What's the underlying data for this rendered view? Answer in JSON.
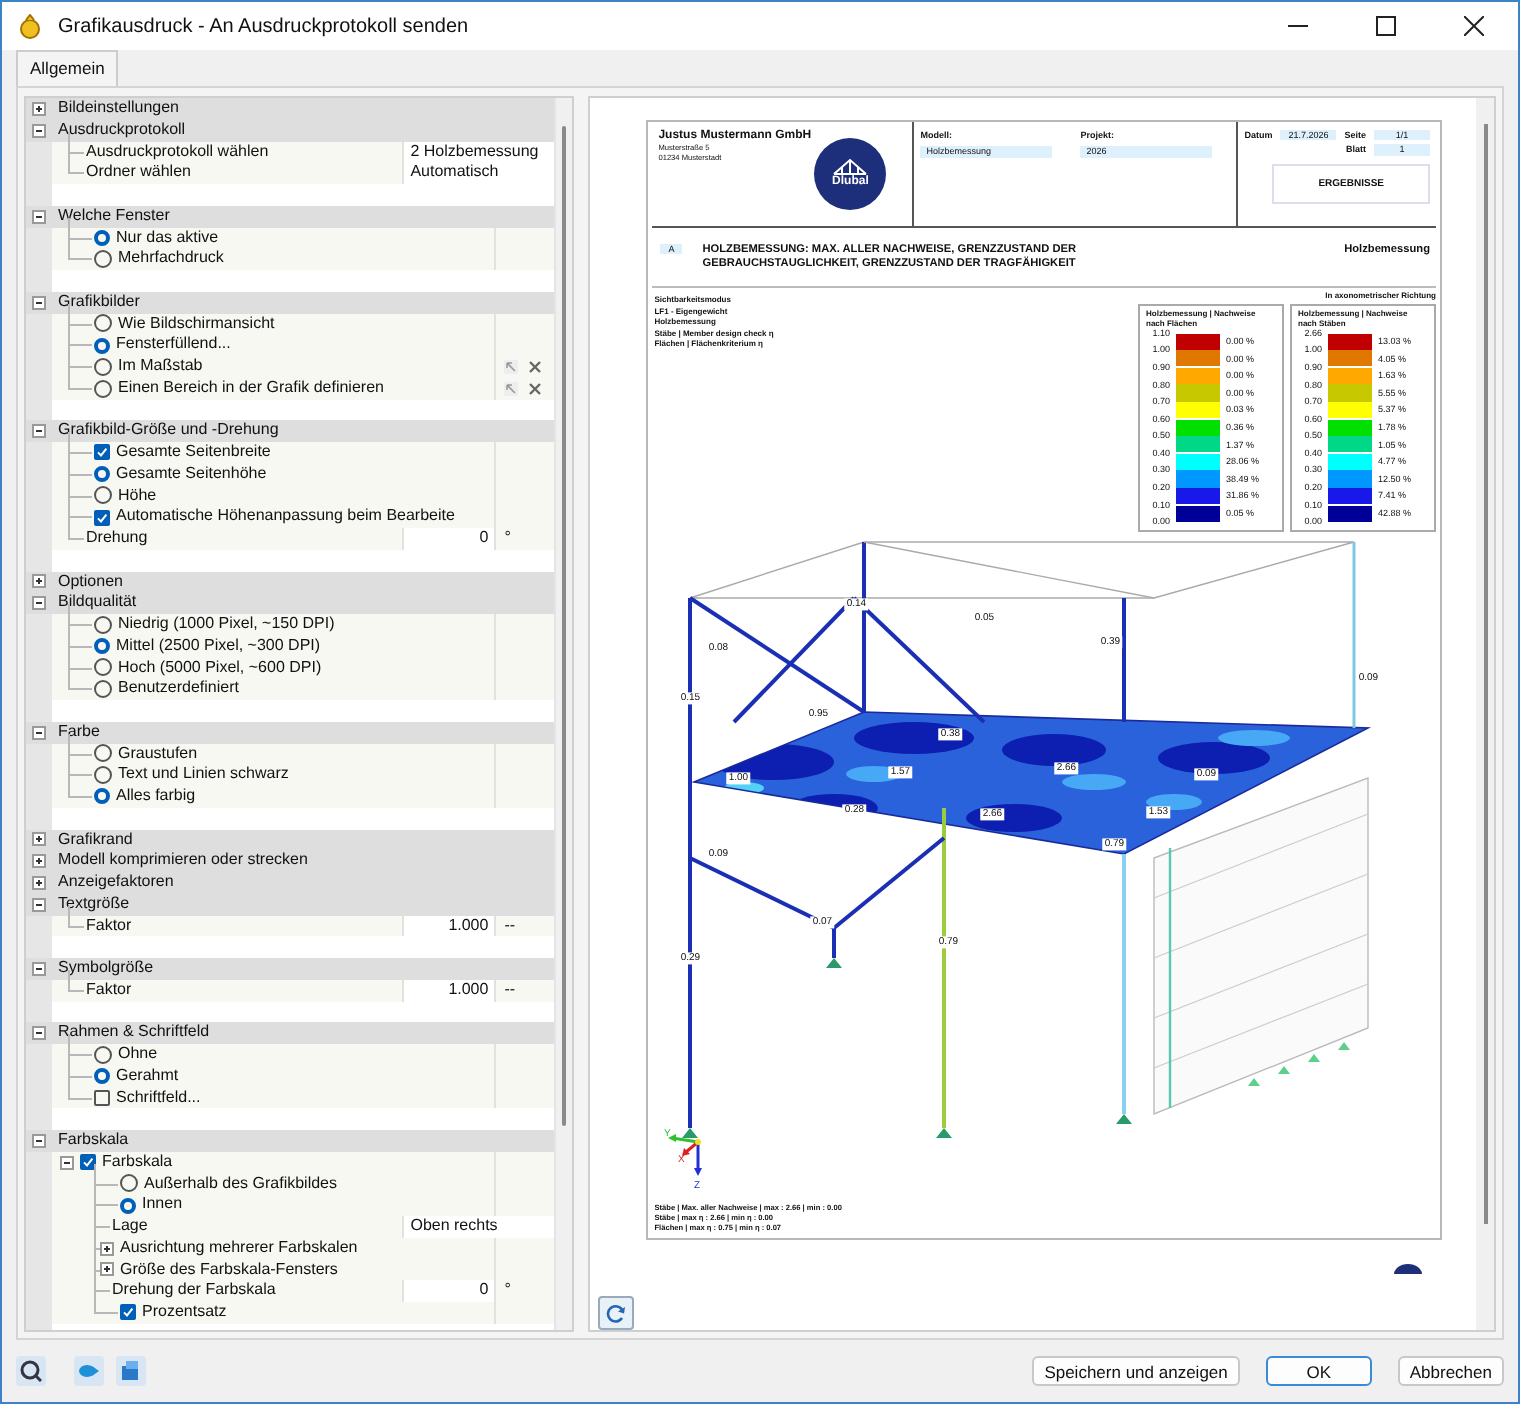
{
  "window": {
    "title": "Grafikausdruck - An Ausdruckprotokoll senden"
  },
  "tabs": [
    {
      "label": "Allgemein",
      "selected": true
    }
  ],
  "settings": [
    {
      "label": "Bildeinstellungen",
      "expanded": false
    },
    {
      "label": "Ausdruckprotokoll",
      "expanded": true,
      "rows": [
        {
          "kind": "field",
          "label": "Ausdruckprotokoll wählen",
          "value": "2 Holzbemessung"
        },
        {
          "kind": "field",
          "label": "Ordner wählen",
          "value": "Automatisch"
        }
      ]
    },
    {
      "label": "Welche Fenster",
      "expanded": true,
      "rows": [
        {
          "kind": "radio",
          "label": "Nur das aktive",
          "selected": true
        },
        {
          "kind": "radio",
          "label": "Mehrfachdruck",
          "selected": false
        }
      ]
    },
    {
      "label": "Grafikbilder",
      "expanded": true,
      "rows": [
        {
          "kind": "radio",
          "label": "Wie Bildschirmansicht",
          "selected": false
        },
        {
          "kind": "radio",
          "label": "Fensterfüllend...",
          "selected": true
        },
        {
          "kind": "radio",
          "label": "Im Maßstab",
          "selected": false,
          "tools": true
        },
        {
          "kind": "radio",
          "label": "Einen Bereich in der Grafik definieren",
          "selected": false,
          "tools": true
        }
      ]
    },
    {
      "label": "Grafikbild-Größe und -Drehung",
      "expanded": true,
      "rows": [
        {
          "kind": "checkbox",
          "label": "Gesamte Seitenbreite",
          "checked": true
        },
        {
          "kind": "radio",
          "label": "Gesamte Seitenhöhe",
          "selected": true
        },
        {
          "kind": "radio",
          "label": "Höhe",
          "selected": false
        },
        {
          "kind": "checkbox",
          "label": "Automatische Höhenanpassung beim Bearbeite",
          "checked": true
        },
        {
          "kind": "field",
          "label": "Drehung",
          "value": "0",
          "unit": "°"
        }
      ]
    },
    {
      "label": "Optionen",
      "expanded": false
    },
    {
      "label": "Bildqualität",
      "expanded": true,
      "rows": [
        {
          "kind": "radio",
          "label": "Niedrig (1000 Pixel, ~150 DPI)",
          "selected": false
        },
        {
          "kind": "radio",
          "label": "Mittel (2500 Pixel, ~300 DPI)",
          "selected": true
        },
        {
          "kind": "radio",
          "label": "Hoch (5000 Pixel, ~600 DPI)",
          "selected": false
        },
        {
          "kind": "radio",
          "label": "Benutzerdefiniert",
          "selected": false
        }
      ]
    },
    {
      "label": "Farbe",
      "expanded": true,
      "rows": [
        {
          "kind": "radio",
          "label": "Graustufen",
          "selected": false
        },
        {
          "kind": "radio",
          "label": "Text und Linien schwarz",
          "selected": false
        },
        {
          "kind": "radio",
          "label": "Alles farbig",
          "selected": true
        }
      ]
    },
    {
      "label": "Grafikrand",
      "expanded": false
    },
    {
      "label": "Modell komprimieren oder strecken",
      "expanded": false
    },
    {
      "label": "Anzeigefaktoren",
      "expanded": false
    },
    {
      "label": "Textgröße",
      "expanded": true,
      "rows": [
        {
          "kind": "field",
          "label": "Faktor",
          "value": "1.000",
          "unit": "--"
        }
      ]
    },
    {
      "label": "Symbolgröße",
      "expanded": true,
      "rows": [
        {
          "kind": "field",
          "label": "Faktor",
          "value": "1.000",
          "unit": "--"
        }
      ]
    },
    {
      "label": "Rahmen & Schriftfeld",
      "expanded": true,
      "rows": [
        {
          "kind": "radio",
          "label": "Ohne",
          "selected": false
        },
        {
          "kind": "radio",
          "label": "Gerahmt",
          "selected": true
        },
        {
          "kind": "checkbox",
          "label": "Schriftfeld...",
          "checked": false
        }
      ]
    },
    {
      "label": "Farbskala",
      "expanded": true,
      "rows": [
        {
          "kind": "checkbox",
          "label": "Farbskala",
          "checked": true,
          "expanded": true,
          "children": [
            {
              "kind": "radio",
              "label": "Außerhalb des Grafikbildes",
              "selected": false
            },
            {
              "kind": "radio",
              "label": "Innen",
              "selected": true
            },
            {
              "kind": "field",
              "label": "Lage",
              "value": "Oben rechts"
            },
            {
              "kind": "group",
              "label": "Ausrichtung mehrerer Farbskalen",
              "expanded": false
            },
            {
              "kind": "group",
              "label": "Größe des Farbskala-Fensters",
              "expanded": false
            },
            {
              "kind": "field",
              "label": "Drehung der Farbskala",
              "value": "0",
              "unit": "°"
            },
            {
              "kind": "checkbox",
              "label": "Prozentsatz",
              "checked": true
            }
          ]
        }
      ]
    }
  ],
  "preview": {
    "header": {
      "company": "Justus Mustermann GmbH",
      "address": [
        "Musterstraße 5",
        "01234 Musterstadt"
      ],
      "logo": "Dlubal",
      "model_label": "Modell:",
      "model": "Holzbemessung",
      "project_label": "Projekt:",
      "project": "2026",
      "date_label": "Datum",
      "date": "21.7.2026",
      "page_label": "Seite",
      "page": "1/1",
      "sheet_label": "Blatt",
      "sheet": "1",
      "badge": "ERGEBNISSE"
    },
    "section": {
      "letter": "A",
      "title": "HOLZBEMESSUNG: MAX. ALLER NACHWEISE, GRENZZUSTAND DER GEBRAUCHSTAUGLICHKEIT, GRENZZUSTAND DER TRAGFÄHIGKEIT",
      "tag": "Holzbemessung"
    },
    "info_lines": [
      "Sichtbarkeitsmodus",
      "LF1 - Eigengewicht",
      "Holzbemessung",
      "Stäbe | Member design check η",
      "Flächen | Flächenkriterium η"
    ],
    "view_note": "In axonometrischer Richtung",
    "legends": [
      {
        "title": "Holzbemessung | Nachweise nach Flächen",
        "ticks": [
          "1.10",
          "1.00",
          "0.90",
          "0.80",
          "0.70",
          "0.60",
          "0.50",
          "0.40",
          "0.30",
          "0.20",
          "0.10",
          "0.00"
        ],
        "bands": [
          {
            "color": "#c00000",
            "percent": "0.00 %"
          },
          {
            "color": "#e07800",
            "percent": "0.00 %"
          },
          {
            "color": "#ffa800",
            "percent": "0.00 %"
          },
          {
            "color": "#c8c800",
            "percent": "0.00 %"
          },
          {
            "color": "#ffff00",
            "percent": "0.03 %"
          },
          {
            "color": "#00e000",
            "percent": "0.36 %"
          },
          {
            "color": "#00d888",
            "percent": "1.37 %"
          },
          {
            "color": "#00ffff",
            "percent": "28.06 %"
          },
          {
            "color": "#0098ff",
            "percent": "38.49 %"
          },
          {
            "color": "#1818e8",
            "percent": "31.86 %"
          },
          {
            "color": "#000098",
            "percent": "0.05 %"
          }
        ]
      },
      {
        "title": "Holzbemessung | Nachweise nach Stäben",
        "ticks": [
          "2.66",
          "1.00",
          "0.90",
          "0.80",
          "0.70",
          "0.60",
          "0.50",
          "0.40",
          "0.30",
          "0.20",
          "0.10",
          "0.00"
        ],
        "bands": [
          {
            "color": "#c00000",
            "percent": "13.03 %"
          },
          {
            "color": "#e07800",
            "percent": "4.05 %"
          },
          {
            "color": "#ffa800",
            "percent": "1.63 %"
          },
          {
            "color": "#c8c800",
            "percent": "5.55 %"
          },
          {
            "color": "#ffff00",
            "percent": "5.37 %"
          },
          {
            "color": "#00e000",
            "percent": "1.78 %"
          },
          {
            "color": "#00d888",
            "percent": "1.05 %"
          },
          {
            "color": "#00ffff",
            "percent": "4.77 %"
          },
          {
            "color": "#0098ff",
            "percent": "12.50 %"
          },
          {
            "color": "#1818e8",
            "percent": "7.41 %"
          },
          {
            "color": "#000098",
            "percent": "42.88 %"
          }
        ]
      }
    ],
    "member_labels": [
      "0.14",
      "0.05",
      "0.08",
      "0.39",
      "0.15",
      "0.09",
      "0.95",
      "0.38",
      "1.00",
      "1.57",
      "2.66",
      "0.09",
      "0.28",
      "2.66",
      "1.53",
      "0.79",
      "0.09",
      "0.29",
      "0.07",
      "0.79"
    ],
    "axis_labels": [
      "Y",
      "X",
      "Z"
    ],
    "footer_lines": [
      "Stäbe | Max. aller Nachweise | max : 2.66 | min : 0.00",
      "Stäbe | max η : 2.66 | min η : 0.00",
      "Flächen | max η : 0.75 | min η : 0.07"
    ]
  },
  "buttons": [
    {
      "label": "Speichern und anzeigen",
      "default": false
    },
    {
      "label": "OK",
      "default": true
    },
    {
      "label": "Abbrechen",
      "default": false
    }
  ]
}
